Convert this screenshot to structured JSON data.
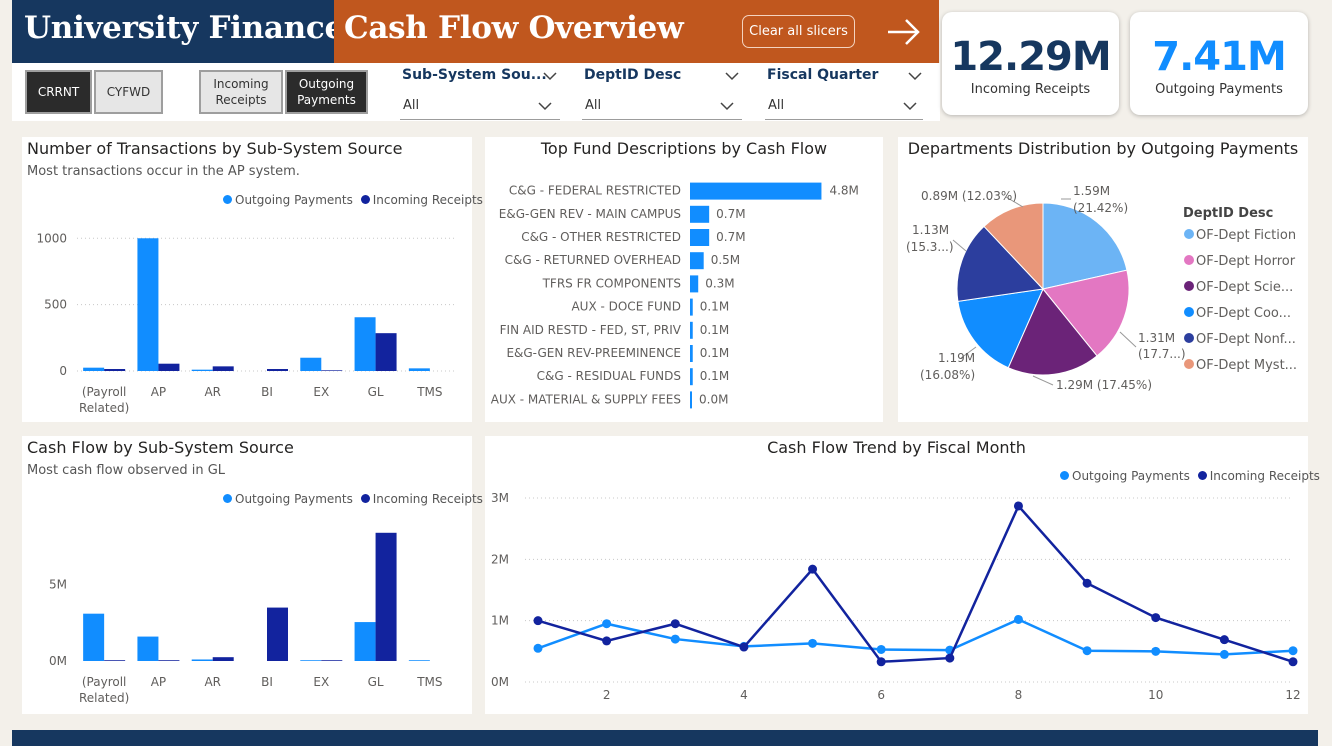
{
  "header": {
    "org_title": "University Finance",
    "page_title": "Cash Flow Overview",
    "clear_button": "Clear all slicers",
    "nav_icon": "arrow-right-icon"
  },
  "colors": {
    "navy": "#16375f",
    "orange": "#c0571e",
    "outgoing": "#118dff",
    "incoming": "#12239e"
  },
  "toggles": {
    "period": [
      "CRRNT",
      "CYFWD"
    ],
    "flow": [
      "Incoming Receipts",
      "Outgoing Payments"
    ],
    "active_period": "CRRNT",
    "active_flow": "Outgoing Payments"
  },
  "slicers": [
    {
      "title": "Sub-System Sou...",
      "value": "All"
    },
    {
      "title": "DeptID Desc",
      "value": "All"
    },
    {
      "title": "Fiscal Quarter",
      "value": "All"
    }
  ],
  "kpis": [
    {
      "value": "12.29M",
      "label": "Incoming Receipts"
    },
    {
      "value": "7.41M",
      "label": "Outgoing Payments"
    }
  ],
  "legend": {
    "outgoing": "Outgoing Payments",
    "incoming": "Incoming Receipts"
  },
  "panels": {
    "transactions": {
      "title": "Number of Transactions by Sub-System Source",
      "subtitle": "Most transactions occur in the AP system."
    },
    "funds": {
      "title": "Top Fund Descriptions by Cash Flow"
    },
    "departments": {
      "title": "Departments Distribution by Outgoing Payments",
      "legend_title": "DeptID Desc"
    },
    "cashflow": {
      "title": "Cash Flow by Sub-System Source",
      "subtitle": "Most cash flow observed in GL"
    },
    "trend": {
      "title": "Cash Flow Trend by Fiscal Month"
    }
  },
  "chart_data": [
    {
      "type": "bar",
      "id": "transactions",
      "title": "Number of Transactions by Sub-System Source",
      "categories": [
        "(Payroll Related)",
        "AP",
        "AR",
        "BI",
        "EX",
        "GL",
        "TMS"
      ],
      "series": [
        {
          "name": "Outgoing Payments",
          "values": [
            25,
            1000,
            10,
            0,
            100,
            405,
            20
          ]
        },
        {
          "name": "Incoming Receipts",
          "values": [
            15,
            55,
            35,
            15,
            5,
            285,
            0
          ]
        }
      ],
      "yticks": [
        "0",
        "500",
        "1000"
      ],
      "ylim": [
        0,
        1100
      ],
      "grid": true,
      "legend": "top-right"
    },
    {
      "type": "bar",
      "id": "funds",
      "orientation": "horizontal",
      "title": "Top Fund Descriptions by Cash Flow",
      "categories": [
        "C&G - FEDERAL RESTRICTED",
        "E&G-GEN REV - MAIN CAMPUS",
        "C&G - OTHER RESTRICTED",
        "C&G - RETURNED OVERHEAD",
        "TFRS FR COMPONENTS",
        "AUX - DOCE FUND",
        "FIN AID RESTD - FED, ST, PRIV",
        "E&G-GEN REV-PREEMINENCE",
        "C&G - RESIDUAL FUNDS",
        "AUX - MATERIAL & SUPPLY FEES"
      ],
      "values": [
        4.8,
        0.7,
        0.7,
        0.5,
        0.3,
        0.1,
        0.1,
        0.1,
        0.1,
        0.0
      ],
      "labels": [
        "4.8M",
        "0.7M",
        "0.7M",
        "0.5M",
        "0.3M",
        "0.1M",
        "0.1M",
        "0.1M",
        "0.1M",
        "0.0M"
      ],
      "xlim": [
        0,
        6.5
      ]
    },
    {
      "type": "pie",
      "id": "departments",
      "title": "Departments Distribution by Outgoing Payments",
      "legend_title": "DeptID Desc",
      "slices": [
        {
          "label": "OF-Dept Fiction",
          "value": 1.59,
          "pct": 21.42,
          "color": "#6cb4f5",
          "callout": [
            "1.59M",
            "(21.42%)"
          ]
        },
        {
          "label": "OF-Dept Horror",
          "value": 1.31,
          "pct": 17.7,
          "color": "#e377c2",
          "callout": [
            "1.31M",
            "(17.7...)"
          ]
        },
        {
          "label": "OF-Dept Scie...",
          "value": 1.29,
          "pct": 17.45,
          "color": "#6b2378",
          "callout": [
            "1.29M (17.45%)"
          ]
        },
        {
          "label": "OF-Dept Coo...",
          "value": 1.19,
          "pct": 16.08,
          "color": "#118dff",
          "callout": [
            "1.19M",
            "(16.08%)"
          ]
        },
        {
          "label": "OF-Dept Nonf...",
          "value": 1.13,
          "pct": 15.3,
          "color": "#2c3e9e",
          "callout": [
            "1.13M",
            "(15.3...)"
          ]
        },
        {
          "label": "OF-Dept Myst...",
          "value": 0.89,
          "pct": 12.03,
          "color": "#e9977a",
          "callout": [
            "0.89M (12.03%)"
          ]
        }
      ]
    },
    {
      "type": "bar",
      "id": "cashflow",
      "title": "Cash Flow by Sub-System Source",
      "categories": [
        "(Payroll Related)",
        "AP",
        "AR",
        "BI",
        "EX",
        "GL",
        "TMS"
      ],
      "series": [
        {
          "name": "Outgoing Payments",
          "values": [
            3.1,
            1.6,
            0.1,
            0.0,
            0.05,
            2.55,
            0.05
          ]
        },
        {
          "name": "Incoming Receipts",
          "values": [
            0.05,
            0.05,
            0.25,
            3.5,
            0.05,
            8.4,
            0.0
          ]
        }
      ],
      "yticks": [
        "0M",
        "5M"
      ],
      "ylim": [
        0,
        9.5
      ],
      "legend": "top-right"
    },
    {
      "type": "line",
      "id": "trend",
      "title": "Cash Flow Trend by Fiscal Month",
      "x": [
        1,
        2,
        3,
        4,
        5,
        6,
        7,
        8,
        9,
        10,
        11,
        12
      ],
      "series": [
        {
          "name": "Outgoing Payments",
          "values": [
            0.55,
            0.95,
            0.7,
            0.58,
            0.63,
            0.53,
            0.52,
            1.02,
            0.51,
            0.5,
            0.45,
            0.51
          ]
        },
        {
          "name": "Incoming Receipts",
          "values": [
            1.0,
            0.67,
            0.95,
            0.57,
            1.84,
            0.33,
            0.39,
            2.87,
            1.61,
            1.05,
            0.69,
            0.33
          ]
        }
      ],
      "xticks": [
        "2",
        "4",
        "6",
        "8",
        "10",
        "12"
      ],
      "yticks": [
        "0M",
        "1M",
        "2M",
        "3M"
      ],
      "ylim": [
        0,
        3
      ],
      "grid": true,
      "legend": "top-right"
    }
  ]
}
